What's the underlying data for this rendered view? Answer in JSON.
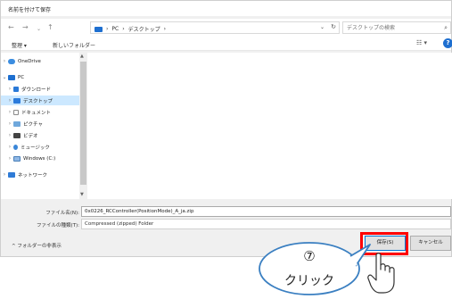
{
  "window": {
    "title": "名前を付けて保存"
  },
  "address": {
    "back": "←",
    "forward": "→",
    "up": "↑",
    "crumbs": [
      "PC",
      "デスクトップ"
    ],
    "separator": "›",
    "search_placeholder": "デスクトップの検索"
  },
  "toolbar": {
    "organize": "整理 ▾",
    "new_folder": "新しいフォルダー"
  },
  "nav": {
    "items": [
      {
        "label": "OneDrive",
        "icon": "cloud-icon",
        "expanded": false
      },
      {
        "label": "PC",
        "icon": "pc-icon",
        "expanded": true
      },
      {
        "label": "ダウンロード",
        "icon": "download-icon",
        "expanded": false
      },
      {
        "label": "デスクトップ",
        "icon": "desktop-icon",
        "expanded": false,
        "selected": true
      },
      {
        "label": "ドキュメント",
        "icon": "document-icon",
        "expanded": false
      },
      {
        "label": "ピクチャ",
        "icon": "picture-icon",
        "expanded": false
      },
      {
        "label": "ビデオ",
        "icon": "video-icon",
        "expanded": false
      },
      {
        "label": "ミュージック",
        "icon": "music-icon",
        "expanded": false
      },
      {
        "label": "Windows (C:)",
        "icon": "drive-icon",
        "expanded": false
      },
      {
        "label": "ネットワーク",
        "icon": "network-icon",
        "expanded": false
      }
    ]
  },
  "form": {
    "filename_label": "ファイル名(N):",
    "filename_value": "0x0226_RCController(PositionMode)_A_ja.zip",
    "filetype_label": "ファイルの種類(T):",
    "filetype_value": "Compressed (zipped) Folder"
  },
  "footer": {
    "hide_folders": "^  フォルダーの非表示",
    "save": "保存(S)",
    "cancel": "キャンセル"
  },
  "callout": {
    "step": "⑦",
    "text": "クリック"
  },
  "colors": {
    "accent": "#1e6fd0",
    "selection": "#cce8ff",
    "highlight": "#ff0000"
  }
}
